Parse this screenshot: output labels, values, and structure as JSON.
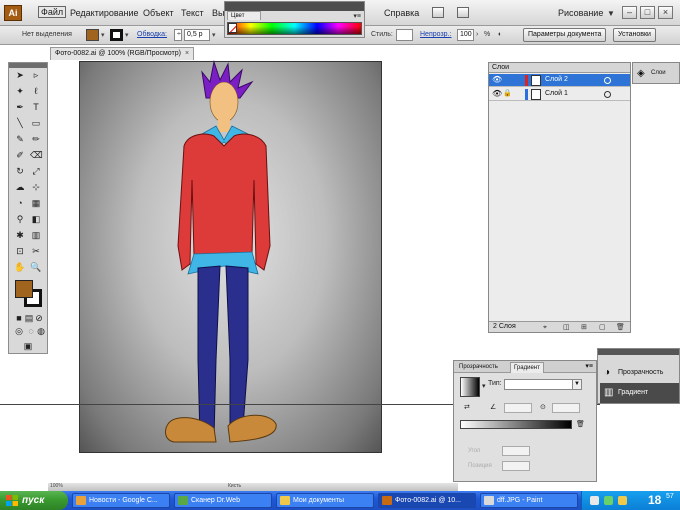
{
  "menubar": {
    "logo": "Ai",
    "items": [
      {
        "label": "Файл",
        "active": true
      },
      {
        "label": "Редактирование"
      },
      {
        "label": "Объект"
      },
      {
        "label": "Текст"
      },
      {
        "label": "Вы"
      },
      {
        "label": "Справка"
      }
    ],
    "workspace": "Рисование",
    "window_buttons": [
      "–",
      "□",
      "×"
    ]
  },
  "controlbar": {
    "selection_label": "Нет выделения",
    "fill_color": "#a0641f",
    "stroke_color": "#111111",
    "stroke_label": "Обводка:",
    "stroke_value": "0,5 p",
    "style_label": "Стиль:",
    "opacity_label": "Непрозр.:",
    "opacity_value": "100",
    "opacity_unit": "%",
    "doc_setup_button": "Параметры документа",
    "prefs_button": "Установки"
  },
  "document": {
    "tab_title": "Фото-0082.ai @ 100% (RGB/Просмотр)"
  },
  "color_panel": {
    "tab_label": "Цвет"
  },
  "layers_panel": {
    "title": "Слои",
    "layers": [
      {
        "name": "Слой 2",
        "selected": true
      },
      {
        "name": "Слой 1",
        "selected": false
      }
    ],
    "footer": "2 Слоя"
  },
  "dock": {
    "label": "Слои"
  },
  "gradient_panel": {
    "tab_transparency": "Прозрачность",
    "tab_gradient": "Градиент",
    "type_label": "Тип:",
    "angle_label": "Угол",
    "location_label": "Позиция"
  },
  "transparency_panel": {
    "items": [
      "Прозрачность",
      "Градиент"
    ]
  },
  "status": {
    "zoom": "100%",
    "mode": "Кисть"
  },
  "taskbar": {
    "start_label": "пуск",
    "tasks": [
      {
        "label": "Новости - Google C...",
        "icon_color": "#e8a13b"
      },
      {
        "label": "Сканер Dr.Web",
        "icon_color": "#5aa845"
      },
      {
        "label": "Мои документы",
        "icon_color": "#f0c84a"
      },
      {
        "label": "Фото-0082.ai @ 10...",
        "icon_color": "#c76a12",
        "active": true
      },
      {
        "label": "dff.JPG - Paint",
        "icon_color": "#d9d9d9"
      }
    ],
    "clock": "18",
    "clock_suffix": "57"
  }
}
